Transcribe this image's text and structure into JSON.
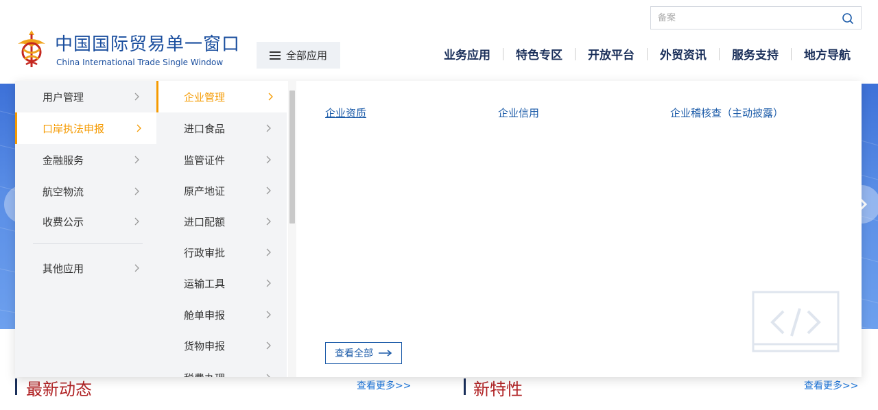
{
  "header": {
    "logo_cn": "中国国际贸易单一窗口",
    "logo_en": "China International Trade Single Window",
    "all_apps_label": "全部应用",
    "search": {
      "placeholder": "备案",
      "value": ""
    },
    "nav": [
      "业务应用",
      "特色专区",
      "开放平台",
      "外贸资讯",
      "服务支持",
      "地方导航"
    ]
  },
  "menu": {
    "level1": [
      {
        "label": "用户管理",
        "active": false
      },
      {
        "label": "口岸执法申报",
        "active": true
      },
      {
        "label": "金融服务",
        "active": false
      },
      {
        "label": "航空物流",
        "active": false
      },
      {
        "label": "收费公示",
        "active": false
      },
      {
        "label": "其他应用",
        "active": false
      }
    ],
    "level2": [
      {
        "label": "企业管理",
        "active": true
      },
      {
        "label": "进口食品",
        "active": false
      },
      {
        "label": "监管证件",
        "active": false
      },
      {
        "label": "原产地证",
        "active": false
      },
      {
        "label": "进口配额",
        "active": false
      },
      {
        "label": "行政审批",
        "active": false
      },
      {
        "label": "运输工具",
        "active": false
      },
      {
        "label": "舱单申报",
        "active": false
      },
      {
        "label": "货物申报",
        "active": false
      },
      {
        "label": "税费办理",
        "active": false
      }
    ],
    "level3": [
      {
        "label": "企业资质",
        "underline": true
      },
      {
        "label": "企业信用",
        "underline": false
      },
      {
        "label": "企业稽核查（主动披露）",
        "underline": false
      }
    ],
    "view_all_label": "查看全部"
  },
  "sections": {
    "latest_news": {
      "title": "最新动态",
      "more": "查看更多>>"
    },
    "new_features": {
      "title": "新特性",
      "more": "查看更多>>"
    }
  },
  "colors": {
    "brand_blue": "#1a4e9e",
    "accent_orange": "#f59a00",
    "link_blue": "#1a5aa8",
    "section_red": "#b02224",
    "nav_dark": "#1a2f5a"
  }
}
